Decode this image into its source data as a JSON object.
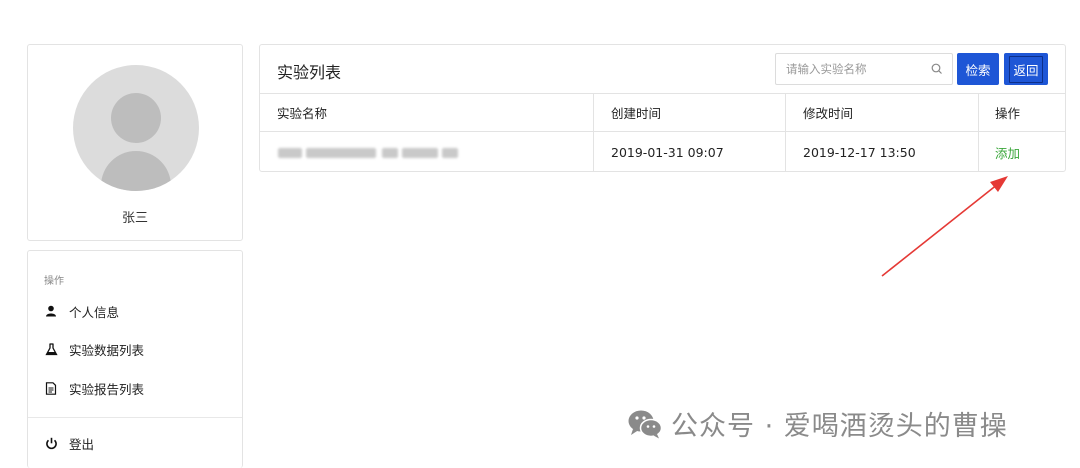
{
  "user": {
    "name": "张三"
  },
  "menu": {
    "section_label": "操作",
    "items": [
      {
        "label": "个人信息",
        "icon": "person-icon"
      },
      {
        "label": "实验数据列表",
        "icon": "flask-icon"
      },
      {
        "label": "实验报告列表",
        "icon": "document-icon"
      }
    ],
    "logout": {
      "label": "登出",
      "icon": "power-icon"
    }
  },
  "main": {
    "title": "实验列表",
    "search": {
      "placeholder": "请输入实验名称",
      "value": "",
      "icon": "search-icon"
    },
    "search_button": "检索",
    "back_button": "返回",
    "table": {
      "columns": [
        "实验名称",
        "创建时间",
        "修改时间",
        "操作"
      ],
      "rows": [
        {
          "name": "",
          "created": "2019-01-31 09:07",
          "modified": "2019-12-17 13:50",
          "action": "添加"
        }
      ]
    }
  },
  "watermark": {
    "text": "公众号 · 爱喝酒烫头的曹操",
    "icon": "wechat-icon"
  },
  "colors": {
    "primary": "#1e56d6",
    "action_green": "#3aa63a",
    "arrow_red": "#e53935",
    "border": "#e3e3e3"
  }
}
